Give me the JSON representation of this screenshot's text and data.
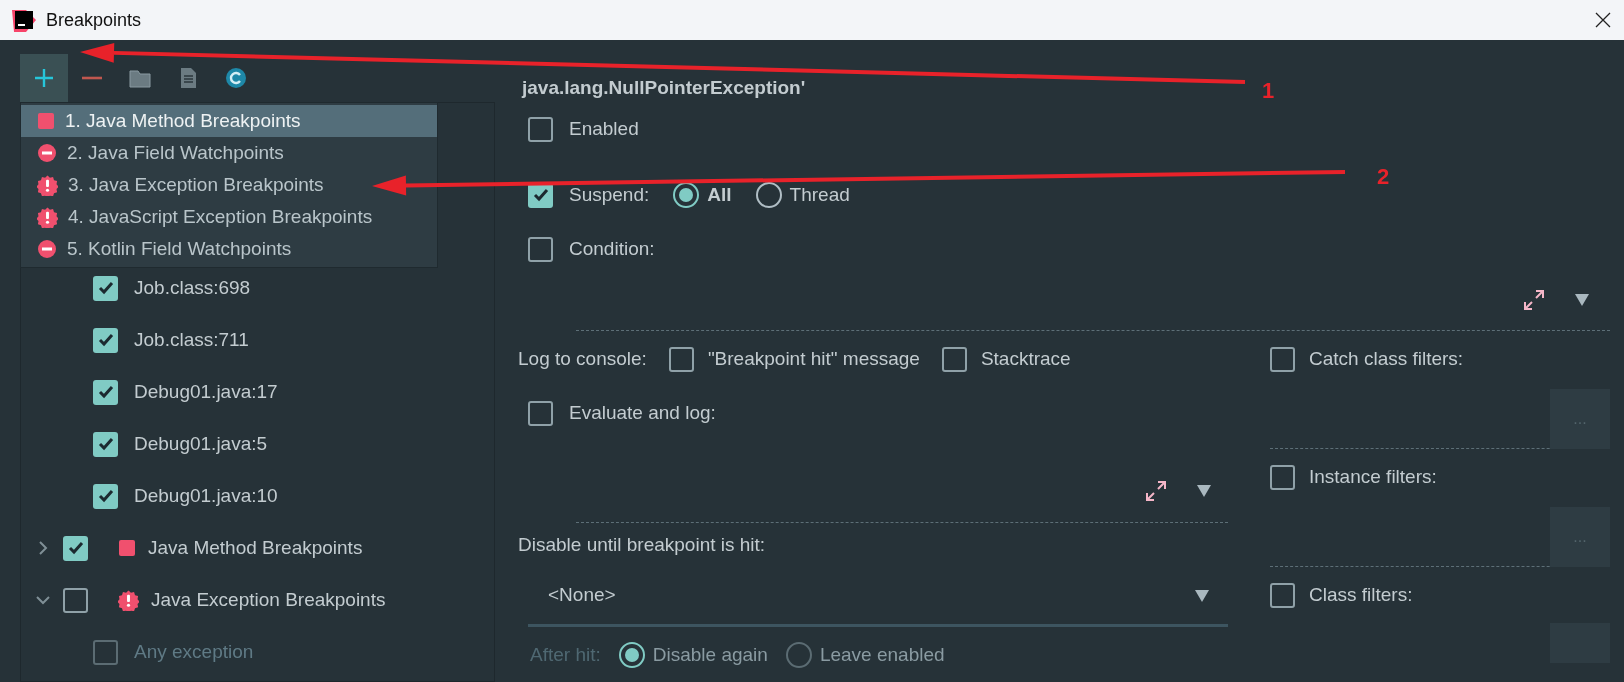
{
  "window": {
    "title": "Breakpoints"
  },
  "toolbar": [
    {
      "kind": "add",
      "selected": true
    },
    {
      "kind": "remove",
      "selected": false
    },
    {
      "kind": "folder",
      "selected": false
    },
    {
      "kind": "file",
      "selected": false
    },
    {
      "kind": "class",
      "selected": false
    }
  ],
  "add_menu": {
    "items": [
      {
        "label": "1. Java Method Breakpoints",
        "kind": "method",
        "selected": true
      },
      {
        "label": "2. Java Field Watchpoints",
        "kind": "field",
        "selected": false
      },
      {
        "label": "3. Java Exception Breakpoints",
        "kind": "exception",
        "selected": false
      },
      {
        "label": "4. JavaScript Exception Breakpoints",
        "kind": "exception",
        "selected": false
      },
      {
        "label": "5. Kotlin Field Watchpoints",
        "kind": "field",
        "selected": false
      }
    ]
  },
  "tree": {
    "items": [
      {
        "children": [
          {
            "label": "Job.class:698",
            "checked": true,
            "disabled": false
          },
          {
            "label": "Job.class:711",
            "checked": true,
            "disabled": false
          },
          {
            "label": "Debug01.java:17",
            "checked": true,
            "disabled": false
          },
          {
            "label": "Debug01.java:5",
            "checked": true,
            "disabled": false
          },
          {
            "label": "Debug01.java:10",
            "checked": true,
            "disabled": false
          }
        ]
      },
      {
        "label": "Java Method Breakpoints",
        "kind": "method",
        "checked": true,
        "expanded": false
      },
      {
        "label": "Java Exception Breakpoints",
        "kind": "exception",
        "checked": false,
        "expanded": true,
        "children": [
          {
            "label": "Any exception",
            "checked": false,
            "disabled": true
          }
        ]
      }
    ]
  },
  "details": {
    "title": "java.lang.NullPointerException'",
    "enabled": {
      "label": "Enabled",
      "checked": false
    },
    "suspend": {
      "label": "Suspend:",
      "checked": true,
      "options": [
        {
          "label": "All",
          "selected": true
        },
        {
          "label": "Thread",
          "selected": false
        }
      ]
    },
    "condition": {
      "label": "Condition:",
      "checked": false
    },
    "log": {
      "label": "Log to console:",
      "options": [
        {
          "label": "\"Breakpoint hit\" message",
          "checked": false
        },
        {
          "label": "Stacktrace",
          "checked": false
        }
      ]
    },
    "evaluate": {
      "label": "Evaluate and log:",
      "checked": false
    },
    "disable_until": {
      "label": "Disable until breakpoint is hit:",
      "value": "<None>"
    },
    "after_hit": {
      "label": "After hit:",
      "disabled": true,
      "options": [
        {
          "label": "Disable again",
          "selected": true
        },
        {
          "label": "Leave enabled",
          "selected": false
        }
      ]
    },
    "filters": [
      {
        "label": "Catch class filters:",
        "checked": false,
        "button": "..."
      },
      {
        "label": "Instance filters:",
        "checked": false,
        "button": "..."
      },
      {
        "label": "Class filters:",
        "checked": false
      }
    ]
  },
  "annotations": [
    {
      "label": "1"
    },
    {
      "label": "2"
    }
  ]
}
